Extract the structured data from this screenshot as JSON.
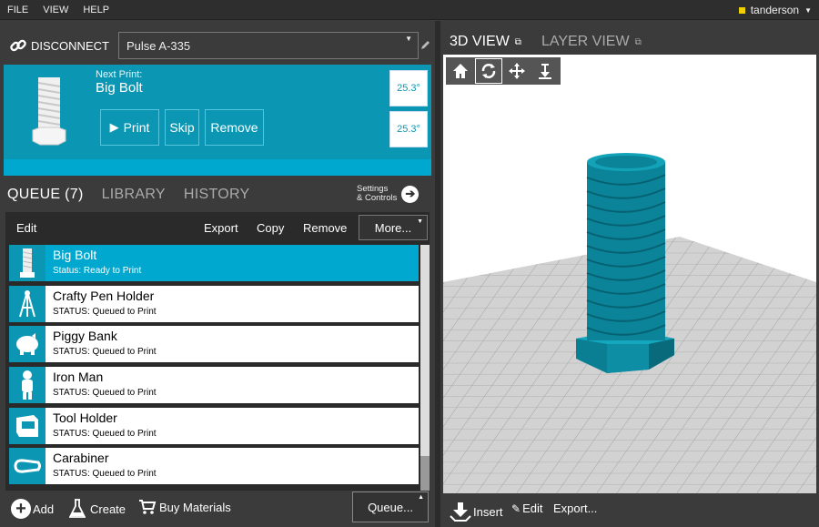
{
  "menu": {
    "file": "FILE",
    "view": "VIEW",
    "help": "HELP",
    "user": "tanderson"
  },
  "connection": {
    "disconnect_label": "DISCONNECT",
    "printer": "Pulse A-335"
  },
  "next_print": {
    "label": "Next Print:",
    "title": "Big Bolt",
    "print_label": "Print",
    "skip_label": "Skip",
    "remove_label": "Remove",
    "temp1": "25.3°",
    "temp2": "25.3°"
  },
  "tabs": {
    "queue": "QUEUE (7)",
    "library": "LIBRARY",
    "history": "HISTORY",
    "settings_line1": "Settings",
    "settings_line2": "& Controls"
  },
  "queue_toolbar": {
    "edit": "Edit",
    "export": "Export",
    "copy": "Copy",
    "remove": "Remove",
    "more": "More..."
  },
  "queue": [
    {
      "name": "Big Bolt",
      "status": "Status: Ready to Print",
      "icon": "bolt-icon"
    },
    {
      "name": "Crafty Pen Holder",
      "status": "STATUS: Queued to Print",
      "icon": "pen-holder-icon"
    },
    {
      "name": "Piggy Bank",
      "status": "STATUS: Queued to Print",
      "icon": "piggy-bank-icon"
    },
    {
      "name": "Iron Man",
      "status": "STATUS: Queued to Print",
      "icon": "iron-man-icon"
    },
    {
      "name": "Tool Holder",
      "status": "STATUS: Queued to Print",
      "icon": "tool-holder-icon"
    },
    {
      "name": "Carabiner",
      "status": "STATUS: Queued to Print",
      "icon": "carabiner-icon"
    }
  ],
  "bottom": {
    "add": "Add",
    "create": "Create",
    "buy": "Buy Materials",
    "queue": "Queue..."
  },
  "view": {
    "tab_3d": "3D VIEW",
    "tab_layer": "LAYER VIEW",
    "insert": "Insert",
    "edit": "Edit",
    "export": "Export..."
  },
  "colors": {
    "accent": "#0b97b4",
    "selected": "#00a8d0",
    "model": "#0b8499"
  }
}
